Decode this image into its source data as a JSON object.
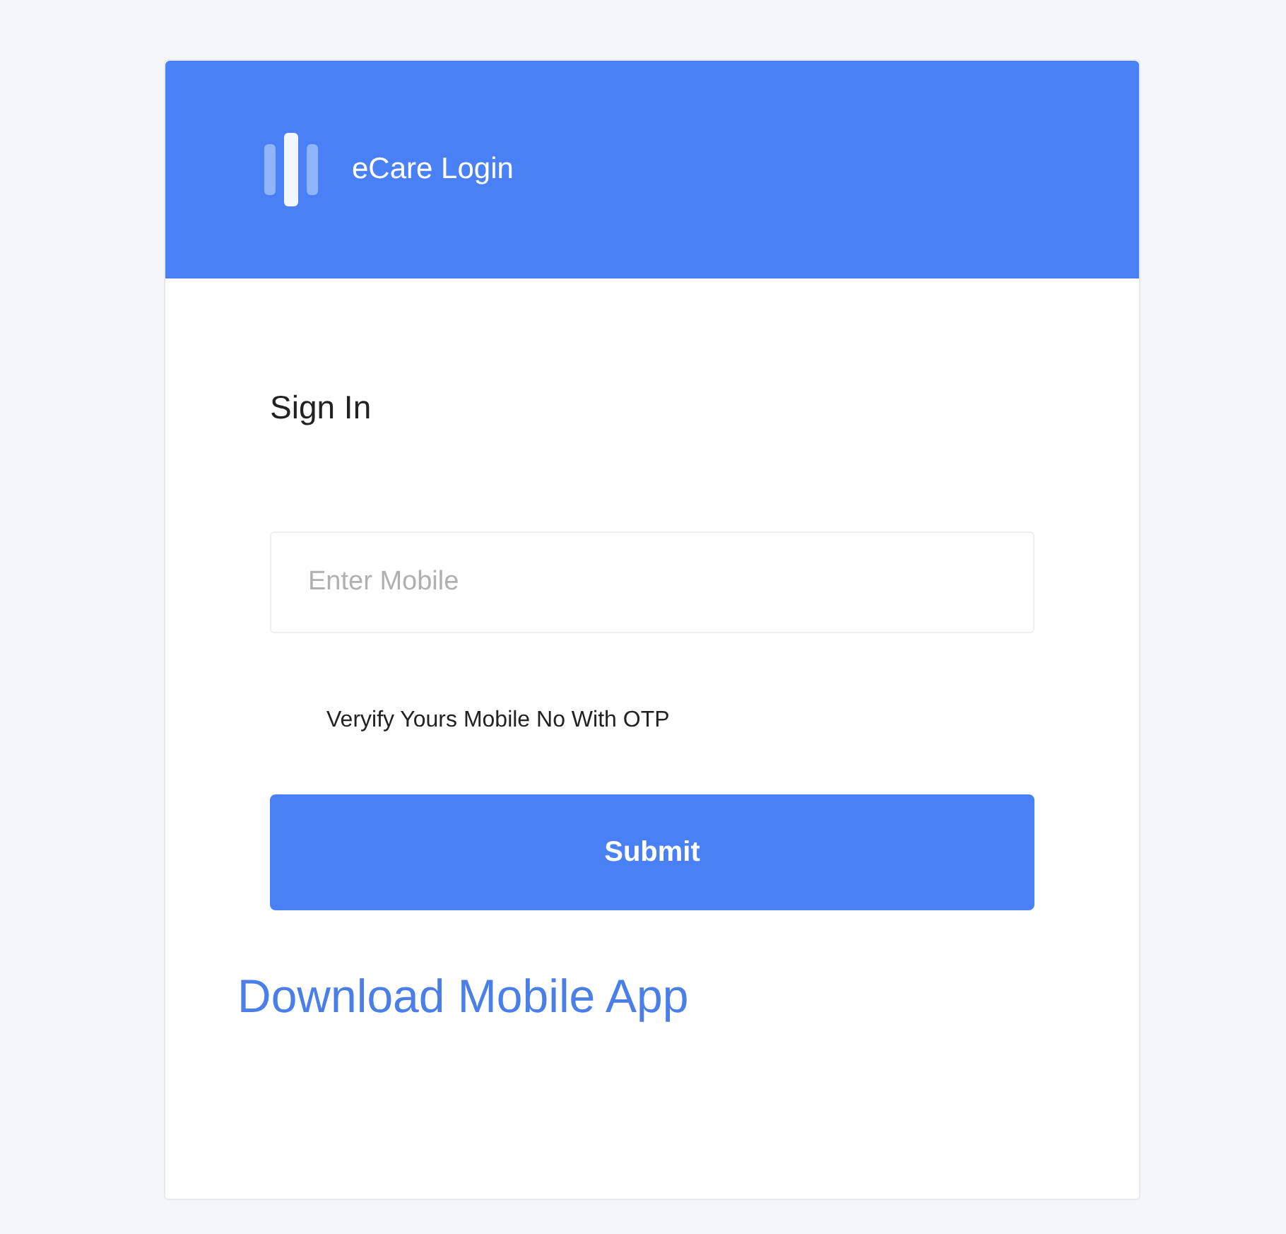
{
  "header": {
    "title": "eCare Login"
  },
  "form": {
    "heading": "Sign In",
    "mobile_field": {
      "placeholder": "Enter Mobile"
    },
    "hint": "Veryify Yours Mobile No With OTP",
    "submit": "Submit"
  },
  "download_link": "Download Mobile App"
}
